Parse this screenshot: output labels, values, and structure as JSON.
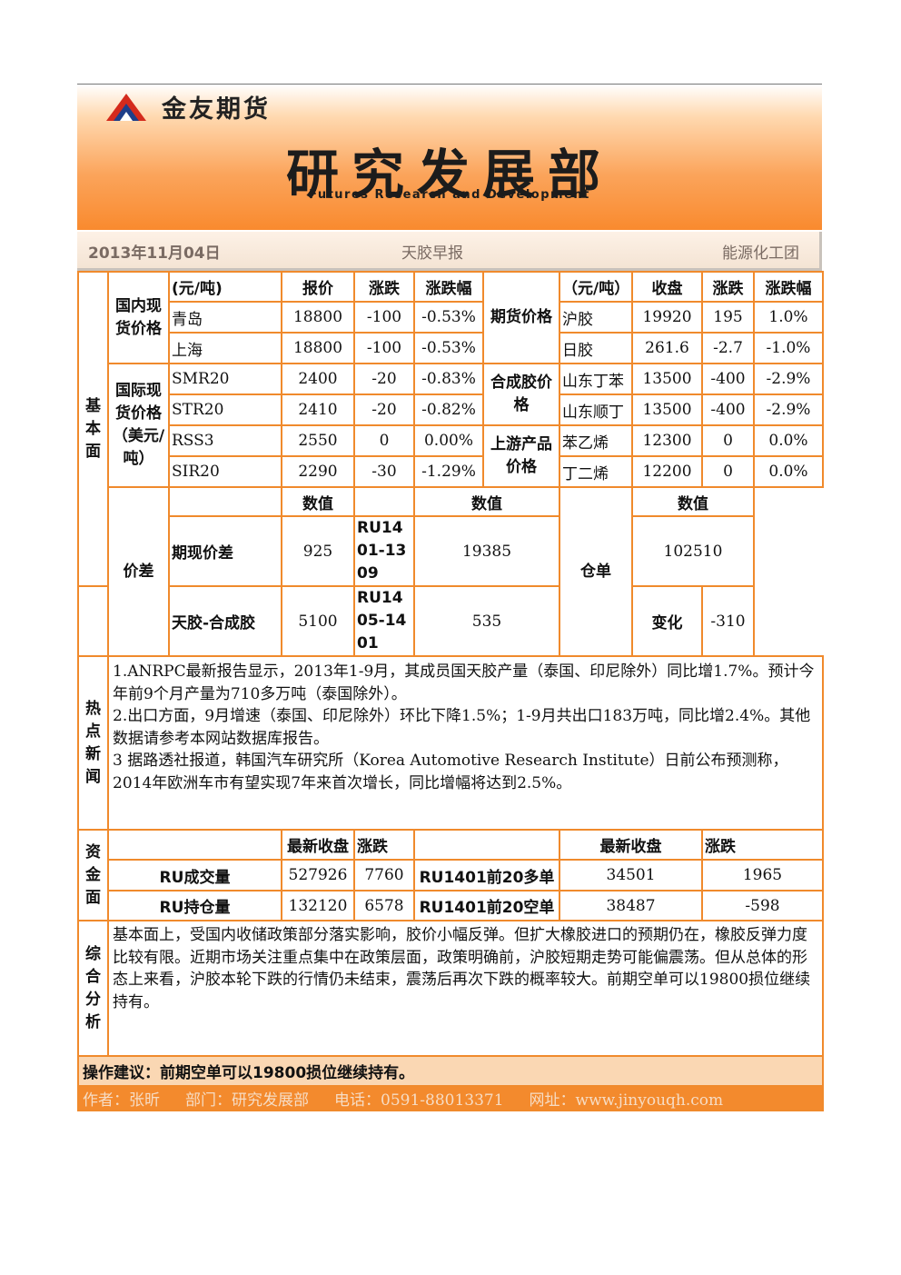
{
  "header": {
    "company": "金友期货",
    "department_cn": "研究发展部",
    "department_en": "Futures Research and Development"
  },
  "infobar": {
    "date": "2013年11月04日",
    "report_title": "天胶早报",
    "group": "能源化工团"
  },
  "fundamentals": {
    "section_label": "基本面",
    "domestic": {
      "label": "国内现货价格",
      "headers": [
        "(元/吨)",
        "报价",
        "涨跌",
        "涨跌幅"
      ],
      "rows": [
        [
          "青岛",
          "18800",
          "-100",
          "-0.53%"
        ],
        [
          "上海",
          "18800",
          "-100",
          "-0.53%"
        ]
      ]
    },
    "international": {
      "label": "国际现货价格（美元/吨）",
      "rows": [
        [
          "SMR20",
          "2400",
          "-20",
          "-0.83%"
        ],
        [
          "STR20",
          "2410",
          "-20",
          "-0.82%"
        ],
        [
          "RSS3",
          "2550",
          "0",
          "0.00%"
        ],
        [
          "SIR20",
          "2290",
          "-30",
          "-1.29%"
        ]
      ]
    },
    "futures": {
      "label": "期货价格",
      "headers": [
        "（元/吨）",
        "收盘",
        "涨跌",
        "涨跌幅"
      ],
      "rows": [
        [
          "沪胶",
          "19920",
          "195",
          "1.0%"
        ],
        [
          "日胶",
          "261.6",
          "-2.7",
          "-1.0%"
        ]
      ]
    },
    "synthetic": {
      "label": "合成胶价格",
      "rows": [
        [
          "山东丁苯",
          "13500",
          "-400",
          "-2.9%"
        ],
        [
          "山东顺丁",
          "13500",
          "-400",
          "-2.9%"
        ]
      ]
    },
    "upstream": {
      "label": "上游产品价格",
      "rows": [
        [
          "苯乙烯",
          "12300",
          "0",
          "0.0%"
        ],
        [
          "丁二烯",
          "12200",
          "0",
          "0.0%"
        ]
      ]
    },
    "spread": {
      "label": "价差",
      "value_header": "数值",
      "rows": [
        {
          "name": "期现价差",
          "value": "925",
          "contract": "RU1401-1309",
          "contract_value": "19385"
        },
        {
          "name": "天胶-合成胶",
          "value": "5100",
          "contract": "RU1405-1401",
          "contract_value": "535"
        }
      ]
    },
    "warehouse": {
      "label": "仓单",
      "value_header": "数值",
      "value": "102510",
      "change_label": "变化",
      "change": "-310"
    }
  },
  "news": {
    "section_label": "热点新闻",
    "items": [
      "1.ANRPC最新报告显示，2013年1-9月，其成员国天胶产量（泰国、印尼除外）同比增1.7%。预计今年前9个月产量为710多万吨（泰国除外）。",
      "2.出口方面，9月增速（泰国、印尼除外）环比下降1.5%；1-9月共出口183万吨，同比增2.4%。其他数据请参考本网站数据库报告。",
      "3 据路透社报道，韩国汽车研究所（Korea Automotive Research Institute）日前公布预测称，2014年欧洲车市有望实现7年来首次增长，同比增幅将达到2.5%。"
    ]
  },
  "funds": {
    "section_label": "资金面",
    "headers": [
      "最新收盘",
      "涨跌"
    ],
    "left_rows": [
      [
        "RU成交量",
        "527926",
        "7760"
      ],
      [
        "RU持仓量",
        "132120",
        "6578"
      ]
    ],
    "right_rows": [
      [
        "RU1401前20多单",
        "34501",
        "1965"
      ],
      [
        "RU1401前20空单",
        "38487",
        "-598"
      ]
    ]
  },
  "analysis": {
    "section_label": "综合分析",
    "text": "基本面上，受国内收储政策部分落实影响，胶价小幅反弹。但扩大橡胶进口的预期仍在，橡胶反弹力度比较有限。近期市场关注重点集中在政策层面，政策明确前，沪胶短期走势可能偏震荡。但从总体的形态上来看，沪胶本轮下跌的行情仍未结束，震荡后再次下跌的概率较大。前期空单可以19800损位继续持有。"
  },
  "advice": "操作建议：前期空单可以19800损位继续持有。",
  "footer": {
    "author": "作者：张昕",
    "dept": "部门：研究发展部",
    "phone": "电话：0591-88013371",
    "site": "网址：www.jinyouqh.com"
  },
  "colors": {
    "border": "#f08a2c",
    "banner_orange": "#f98a2e",
    "footer_bg": "#f38a2d",
    "advice_bg": "#fad7b3"
  }
}
